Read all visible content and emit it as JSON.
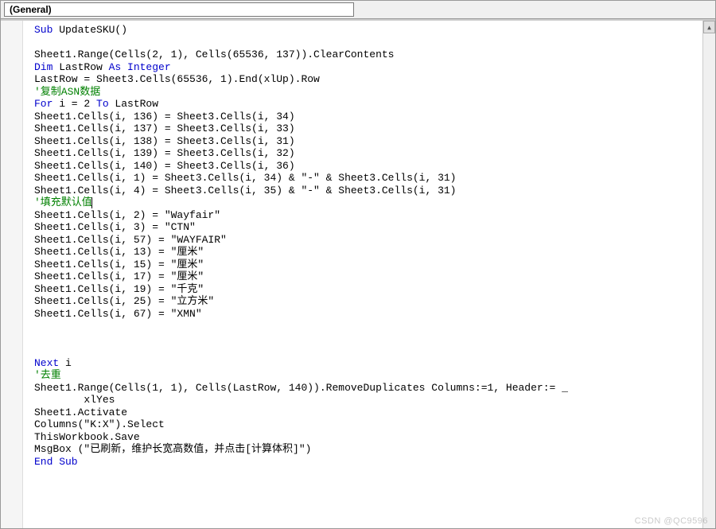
{
  "dropdown": {
    "object_selector": "(General)"
  },
  "code": {
    "tokens": [
      [
        {
          "t": "kw",
          "v": "Sub"
        },
        {
          "t": "p",
          "v": " UpdateSKU()"
        }
      ],
      [],
      [
        {
          "t": "p",
          "v": "Sheet1.Range(Cells(2, 1), Cells(65536, 137)).ClearContents"
        }
      ],
      [
        {
          "t": "kw",
          "v": "Dim"
        },
        {
          "t": "p",
          "v": " LastRow "
        },
        {
          "t": "kw",
          "v": "As Integer"
        }
      ],
      [
        {
          "t": "p",
          "v": "LastRow = Sheet3.Cells(65536, 1).End(xlUp).Row"
        }
      ],
      [
        {
          "t": "cm",
          "v": "'复制ASN数据"
        }
      ],
      [
        {
          "t": "kw",
          "v": "For"
        },
        {
          "t": "p",
          "v": " i = 2 "
        },
        {
          "t": "kw",
          "v": "To"
        },
        {
          "t": "p",
          "v": " LastRow"
        }
      ],
      [
        {
          "t": "p",
          "v": "Sheet1.Cells(i, 136) = Sheet3.Cells(i, 34)"
        }
      ],
      [
        {
          "t": "p",
          "v": "Sheet1.Cells(i, 137) = Sheet3.Cells(i, 33)"
        }
      ],
      [
        {
          "t": "p",
          "v": "Sheet1.Cells(i, 138) = Sheet3.Cells(i, 31)"
        }
      ],
      [
        {
          "t": "p",
          "v": "Sheet1.Cells(i, 139) = Sheet3.Cells(i, 32)"
        }
      ],
      [
        {
          "t": "p",
          "v": "Sheet1.Cells(i, 140) = Sheet3.Cells(i, 36)"
        }
      ],
      [
        {
          "t": "p",
          "v": "Sheet1.Cells(i, 1) = Sheet3.Cells(i, 34) & \"-\" & Sheet3.Cells(i, 31)"
        }
      ],
      [
        {
          "t": "p",
          "v": "Sheet1.Cells(i, 4) = Sheet3.Cells(i, 35) & \"-\" & Sheet3.Cells(i, 31)"
        }
      ],
      [
        {
          "t": "cm",
          "v": "'填充默认值"
        },
        {
          "t": "caret",
          "v": ""
        }
      ],
      [
        {
          "t": "p",
          "v": "Sheet1.Cells(i, 2) = \"Wayfair\""
        }
      ],
      [
        {
          "t": "p",
          "v": "Sheet1.Cells(i, 3) = \"CTN\""
        }
      ],
      [
        {
          "t": "p",
          "v": "Sheet1.Cells(i, 57) = \"WAYFAIR\""
        }
      ],
      [
        {
          "t": "p",
          "v": "Sheet1.Cells(i, 13) = \"厘米\""
        }
      ],
      [
        {
          "t": "p",
          "v": "Sheet1.Cells(i, 15) = \"厘米\""
        }
      ],
      [
        {
          "t": "p",
          "v": "Sheet1.Cells(i, 17) = \"厘米\""
        }
      ],
      [
        {
          "t": "p",
          "v": "Sheet1.Cells(i, 19) = \"千克\""
        }
      ],
      [
        {
          "t": "p",
          "v": "Sheet1.Cells(i, 25) = \"立方米\""
        }
      ],
      [
        {
          "t": "p",
          "v": "Sheet1.Cells(i, 67) = \"XMN\""
        }
      ],
      [],
      [],
      [],
      [
        {
          "t": "kw",
          "v": "Next"
        },
        {
          "t": "p",
          "v": " i"
        }
      ],
      [
        {
          "t": "cm",
          "v": "'去重"
        }
      ],
      [
        {
          "t": "p",
          "v": "Sheet1.Range(Cells(1, 1), Cells(LastRow, 140)).RemoveDuplicates Columns:=1, Header:= _"
        }
      ],
      [
        {
          "t": "p",
          "v": "        xlYes"
        }
      ],
      [
        {
          "t": "p",
          "v": "Sheet1.Activate"
        }
      ],
      [
        {
          "t": "p",
          "v": "Columns(\"K:X\").Select"
        }
      ],
      [
        {
          "t": "p",
          "v": "ThisWorkbook.Save"
        }
      ],
      [
        {
          "t": "p",
          "v": "MsgBox (\"已刷新，维护长宽高数值，并点击[计算体积]\")"
        }
      ],
      [
        {
          "t": "kw",
          "v": "End Sub"
        }
      ]
    ]
  },
  "watermark": "CSDN @QC9596"
}
